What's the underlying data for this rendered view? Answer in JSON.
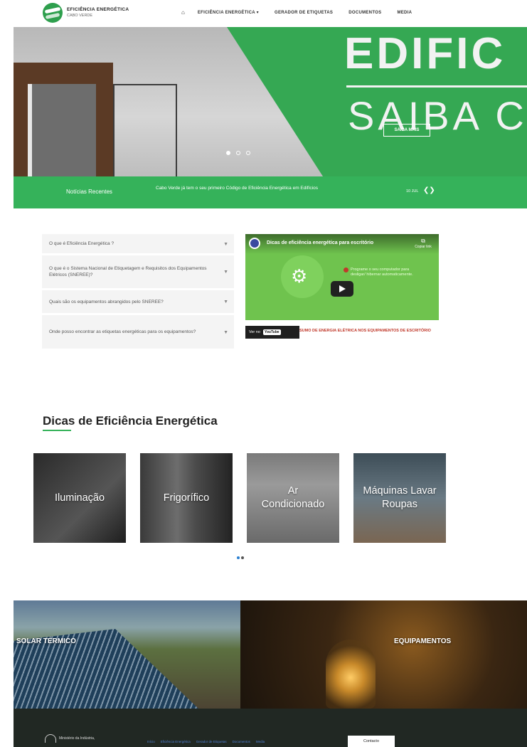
{
  "nav": {
    "logo_title": "EFICIÊNCIA ENERGÉTICA",
    "logo_subtitle": "CABO VERDE",
    "home_icon": "home-icon",
    "items": [
      {
        "label": "EFICIÊNCIA ENERGÉTICA ▾"
      },
      {
        "label": "GERADOR DE ETIQUETAS"
      },
      {
        "label": "DOCUMENTOS"
      },
      {
        "label": "MEDIA"
      }
    ]
  },
  "hero": {
    "headline": "EDIFIC",
    "subheadline": "SAIBA C",
    "button_label": "SAIBA MAIS",
    "slides": 3,
    "active_slide": 1
  },
  "news": {
    "label": "Notícias Recentes",
    "headline": "Cabo Verde já tem o seu primeiro Código de Eficiência Energética em Edifícios",
    "date": "10 JUL",
    "arrows": "❮❯"
  },
  "faq": [
    {
      "question": "O que é Eficiência Energética ?"
    },
    {
      "question": "O que é o Sistema Nacional de Etiquetagem e Requisitos dos Equipamentos Elétricos (SNEREE)?"
    },
    {
      "question": "Quais são os equipamentos abrangidos pelo SNEREE?"
    },
    {
      "question": "Onde posso encontrar as etiquetas energéticas para os equipamentos?"
    }
  ],
  "video": {
    "title": "Dicas de eficiência energética para escritório",
    "copy_label": "Copiar link",
    "description": "Programe o seu computador para desligar/ hibernar automaticamente.",
    "watch_on": "Ver no",
    "youtube": "YouTube",
    "caption": "SUMO DE ENERGIA ELÉTRICA NOS EQUIPAMENTOS DE ESCRITÓRIO"
  },
  "tips": {
    "title": "Dicas de Eficiência Energética",
    "cards": [
      {
        "label": "Iluminação"
      },
      {
        "label": "Frigorífico"
      },
      {
        "label": "Ar Condicionado"
      },
      {
        "label": "Máquinas Lavar Roupas"
      }
    ]
  },
  "banners": [
    {
      "label": "SOLAR TÉRMICO"
    },
    {
      "label": "EQUIPAMENTOS"
    }
  ],
  "footer": {
    "logo_text": "Ministério da Indústria,",
    "links": [
      "Início",
      "Eficiência Energética",
      "Gerador de Etiquetas",
      "Documentos",
      "Media"
    ],
    "contact_label": "Contacto"
  },
  "colors": {
    "brand_green": "#35b25a",
    "footer_bg": "#212823",
    "link_blue": "#4f7fd1"
  }
}
